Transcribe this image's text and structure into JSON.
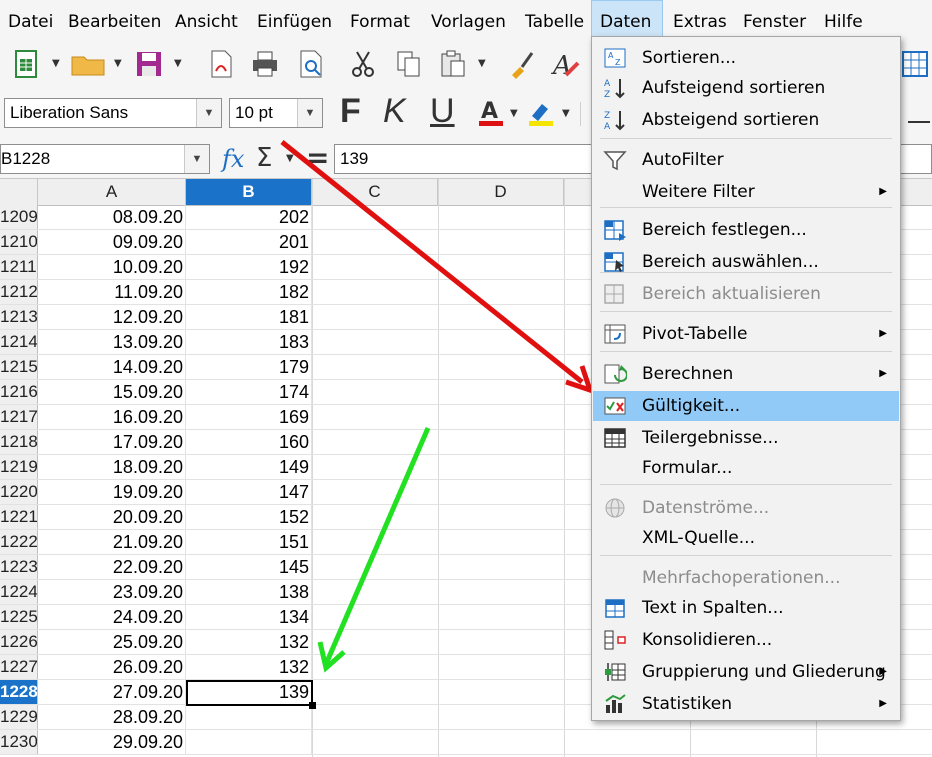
{
  "menubar": {
    "items": [
      {
        "label": "Datei"
      },
      {
        "label": "Bearbeiten"
      },
      {
        "label": "Ansicht"
      },
      {
        "label": "Einfügen"
      },
      {
        "label": "Format"
      },
      {
        "label": "Vorlagen"
      },
      {
        "label": "Tabelle"
      },
      {
        "label": "Daten"
      },
      {
        "label": "Extras"
      },
      {
        "label": "Fenster"
      },
      {
        "label": "Hilfe"
      }
    ],
    "active": "Daten"
  },
  "toolbar": {
    "font_name": "Liberation Sans",
    "font_size": "10 pt",
    "bold": "F",
    "italic": "K",
    "underline": "U"
  },
  "formula_bar": {
    "name_box": "B1228",
    "fx": "fx",
    "sigma": "Σ",
    "equals": "=",
    "value": "139"
  },
  "columns": [
    "A",
    "B",
    "C",
    "D"
  ],
  "rows": [
    {
      "row": "1209",
      "a": "08.09.20",
      "b": "202"
    },
    {
      "row": "1210",
      "a": "09.09.20",
      "b": "201"
    },
    {
      "row": "1211",
      "a": "10.09.20",
      "b": "192"
    },
    {
      "row": "1212",
      "a": "11.09.20",
      "b": "182"
    },
    {
      "row": "1213",
      "a": "12.09.20",
      "b": "181"
    },
    {
      "row": "1214",
      "a": "13.09.20",
      "b": "183"
    },
    {
      "row": "1215",
      "a": "14.09.20",
      "b": "179"
    },
    {
      "row": "1216",
      "a": "15.09.20",
      "b": "174"
    },
    {
      "row": "1217",
      "a": "16.09.20",
      "b": "169"
    },
    {
      "row": "1218",
      "a": "17.09.20",
      "b": "160"
    },
    {
      "row": "1219",
      "a": "18.09.20",
      "b": "149"
    },
    {
      "row": "1220",
      "a": "19.09.20",
      "b": "147"
    },
    {
      "row": "1221",
      "a": "20.09.20",
      "b": "152"
    },
    {
      "row": "1222",
      "a": "21.09.20",
      "b": "151"
    },
    {
      "row": "1223",
      "a": "22.09.20",
      "b": "145"
    },
    {
      "row": "1224",
      "a": "23.09.20",
      "b": "138"
    },
    {
      "row": "1225",
      "a": "24.09.20",
      "b": "134"
    },
    {
      "row": "1226",
      "a": "25.09.20",
      "b": "132"
    },
    {
      "row": "1227",
      "a": "26.09.20",
      "b": "132"
    },
    {
      "row": "1228",
      "a": "27.09.20",
      "b": "139"
    },
    {
      "row": "1229",
      "a": "28.09.20",
      "b": ""
    },
    {
      "row": "1230",
      "a": "29.09.20",
      "b": ""
    }
  ],
  "selected_cell": {
    "row": "1228",
    "column": "B"
  },
  "data_menu": {
    "items": [
      {
        "label": "Sortieren...",
        "icon": "sort-icon"
      },
      {
        "label": "Aufsteigend sortieren",
        "icon": "sort-ascending-icon"
      },
      {
        "label": "Absteigend sortieren",
        "icon": "sort-descending-icon"
      },
      {
        "label": "AutoFilter",
        "icon": "autofilter-icon"
      },
      {
        "label": "Weitere Filter",
        "submenu": true
      },
      {
        "label": "Bereich festlegen...",
        "icon": "define-range-icon"
      },
      {
        "label": "Bereich auswählen...",
        "icon": "select-range-icon"
      },
      {
        "label": "Bereich aktualisieren",
        "icon": "refresh-range-icon",
        "disabled": true
      },
      {
        "label": "Pivot-Tabelle",
        "icon": "pivot-table-icon",
        "submenu": true
      },
      {
        "label": "Berechnen",
        "icon": "calculate-icon",
        "submenu": true
      },
      {
        "label": "Gültigkeit...",
        "icon": "validity-icon",
        "highlighted": true
      },
      {
        "label": "Teilergebnisse...",
        "icon": "subtotals-icon"
      },
      {
        "label": "Formular...",
        "icon": ""
      },
      {
        "label": "Datenströme...",
        "icon": "data-streams-icon",
        "disabled": true
      },
      {
        "label": "XML-Quelle...",
        "icon": ""
      },
      {
        "label": "Mehrfachoperationen...",
        "disabled": true
      },
      {
        "label": "Text in Spalten...",
        "icon": "text-to-columns-icon"
      },
      {
        "label": "Konsolidieren...",
        "icon": "consolidate-icon"
      },
      {
        "label": "Gruppierung und Gliederung",
        "icon": "group-outline-icon",
        "submenu": true
      },
      {
        "label": "Statistiken",
        "icon": "statistics-icon",
        "submenu": true
      }
    ]
  },
  "annotations": {
    "red_arrow_color": "#e01010",
    "green_arrow_color": "#22e022"
  },
  "colors": {
    "selection_blue": "#1a73c8",
    "menu_highlight": "#91c9f7"
  }
}
